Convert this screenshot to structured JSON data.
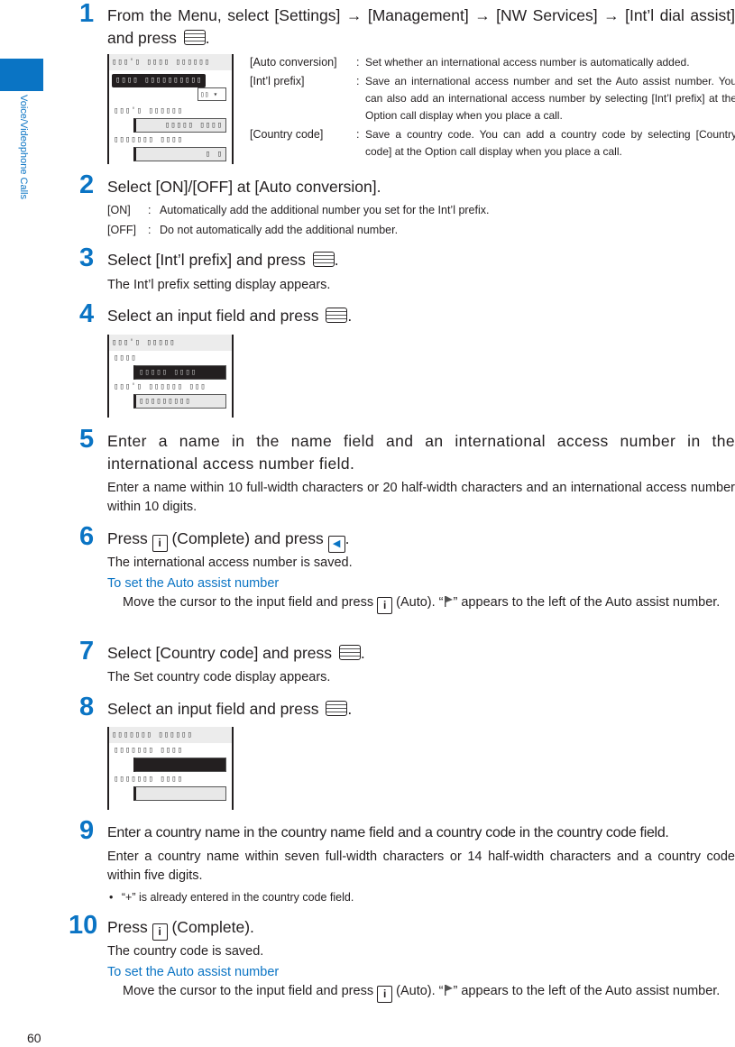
{
  "side_label": "Voice/Videophone Calls",
  "page_number": "60",
  "steps": [
    {
      "num": "1",
      "title": "From the Menu, select [Settings] → [Management] → [NW Services] → [Int’l dial assist] and press"
    },
    {
      "num": "2",
      "title": "Select [ON]/[OFF] at [Auto conversion]."
    },
    {
      "num": "3",
      "title": "Select [Int’l prefix] and press"
    },
    {
      "num": "4",
      "title": "Select an input field and press"
    },
    {
      "num": "5",
      "title": "Enter a name in the name field and an international access number in the international access number field."
    },
    {
      "num": "6",
      "title_a": "Press",
      "title_b": "(Complete) and press"
    },
    {
      "num": "7",
      "title": "Select [Country code] and press"
    },
    {
      "num": "8",
      "title": "Select an input field and press"
    },
    {
      "num": "9",
      "title": "Enter a country name in the country name field and a country code in the country code field."
    },
    {
      "num": "10",
      "title_a": "Press",
      "title_b": "(Complete)."
    }
  ],
  "step1_options": [
    {
      "term": "[Auto conversion]",
      "def": "Set whether an international access number is automatically added."
    },
    {
      "term": "[Int’l prefix]",
      "def": "Save an international access number and set the Auto assist number. You can also add an international access number by selecting [Int’l prefix] at the Option call display when you place a call."
    },
    {
      "term": "[Country code]",
      "def": "Save a country code. You can add a country code by selecting [Country code] at the Option call display when you place a call."
    }
  ],
  "step2_options": [
    {
      "term": "[ON]",
      "def": "Automatically add the additional number you set for the Int’l prefix."
    },
    {
      "term": "[OFF]",
      "def": "Do not automatically add the additional number."
    }
  ],
  "step3_body": "The Int’l prefix setting display appears.",
  "step5_body": "Enter a name within 10 full-width characters or 20 half-width characters and an international access number within 10 digits.",
  "step6_body": "The international access number is saved.",
  "auto_assist_heading": "To set the Auto assist number",
  "auto_assist_a": "Move the cursor to the input field and press",
  "auto_assist_b": "(Auto). “",
  "auto_assist_c": "” appears to the left of the Auto assist number.",
  "step7_body": "The Set country code display appears.",
  "step9_body": "Enter a country name within seven full-width characters or 14 half-width characters and a country code within five digits.",
  "step9_bullet": "“+” is already entered in the country code field.",
  "step10_body": "The country code is saved.",
  "colon": ":",
  "key_i": "i",
  "key_left": "◀",
  "bullet": "•",
  "period": ".",
  "screens": {
    "s1": {
      "title": "▯▯▯'▯ ▯▯▯▯ ▯▯▯▯▯▯",
      "highlight": "▯▯▯▯ ▯▯▯▯▯▯▯▯▯▯",
      "select": "▯▯ ▾",
      "label1": "▯▯▯'▯ ▯▯▯▯▯▯",
      "field1": "▯▯▯▯▯ ▯▯▯▯",
      "label2": "▯▯▯▯▯▯▯ ▯▯▯▯",
      "field2": "▯ ▯"
    },
    "s2": {
      "title": "▯▯▯'▯ ▯▯▯▯▯",
      "label1": "▯▯▯▯",
      "field1": "▯▯▯▯▯ ▯▯▯▯",
      "label2": "▯▯▯'▯ ▯▯▯▯▯▯ ▯▯▯",
      "field2": "▯▯▯▯▯▯▯▯▯"
    },
    "s3": {
      "title": "▯▯▯▯▯▯▯ ▯▯▯▯▯▯",
      "label1": "▯▯▯▯▯▯▯ ▯▯▯▯",
      "field1": "",
      "label2": "▯▯▯▯▯▯▯ ▯▯▯▯",
      "field2": ""
    }
  }
}
